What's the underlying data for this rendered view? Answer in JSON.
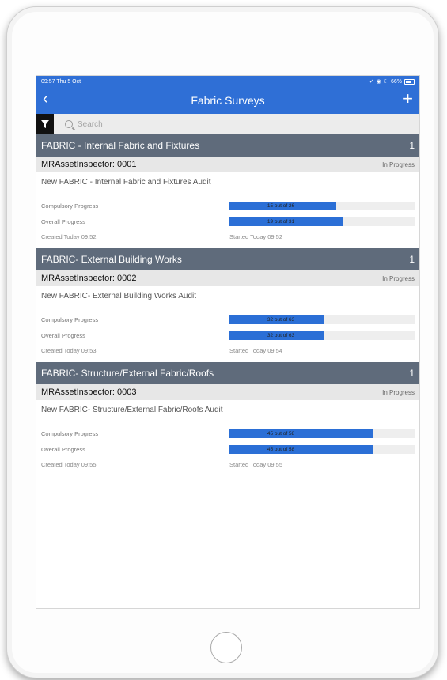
{
  "status_bar": {
    "time": "09:57  Thu 5 Oct",
    "battery": "66%"
  },
  "nav": {
    "back_glyph": "‹",
    "title": "Fabric Surveys",
    "add_glyph": "+"
  },
  "search": {
    "placeholder": "Search"
  },
  "sections": [
    {
      "header": "FABRIC - Internal Fabric and Fixtures",
      "count": "1",
      "inspector": "MRAssetInspector: 0001",
      "status": "In Progress",
      "audit_title": "New FABRIC - Internal Fabric and Fixtures Audit",
      "compulsory_label": "Compulsory Progress",
      "compulsory_text": "15 out of 26",
      "compulsory_fraction": 0.577,
      "overall_label": "Overall Progress",
      "overall_text": "19 out of 31",
      "overall_fraction": 0.613,
      "created": "Created Today 09:52",
      "started": "Started Today 09:52"
    },
    {
      "header": "FABRIC- External Building Works",
      "count": "1",
      "inspector": "MRAssetInspector: 0002",
      "status": "In Progress",
      "audit_title": "New FABRIC- External Building Works Audit",
      "compulsory_label": "Compulsory Progress",
      "compulsory_text": "32 out of 63",
      "compulsory_fraction": 0.508,
      "overall_label": "Overall Progress",
      "overall_text": "32 out of 63",
      "overall_fraction": 0.508,
      "created": "Created Today 09:53",
      "started": "Started Today 09:54"
    },
    {
      "header": "FABRIC- Structure/External Fabric/Roofs",
      "count": "1",
      "inspector": "MRAssetInspector: 0003",
      "status": "In Progress",
      "audit_title": "New FABRIC- Structure/External Fabric/Roofs Audit",
      "compulsory_label": "Compulsory Progress",
      "compulsory_text": "45 out of 58",
      "compulsory_fraction": 0.776,
      "overall_label": "Overall Progress",
      "overall_text": "45 out of 58",
      "overall_fraction": 0.776,
      "created": "Created Today 09:55",
      "started": "Started Today 09:55"
    }
  ],
  "colors": {
    "accent": "#2f6fd6",
    "section_header": "#5f6b7b",
    "progress_fill": "#2b6fd6"
  },
  "icons": {
    "filter": "filter-icon",
    "search": "search-icon",
    "back": "back-chevron-icon",
    "add": "plus-icon"
  }
}
